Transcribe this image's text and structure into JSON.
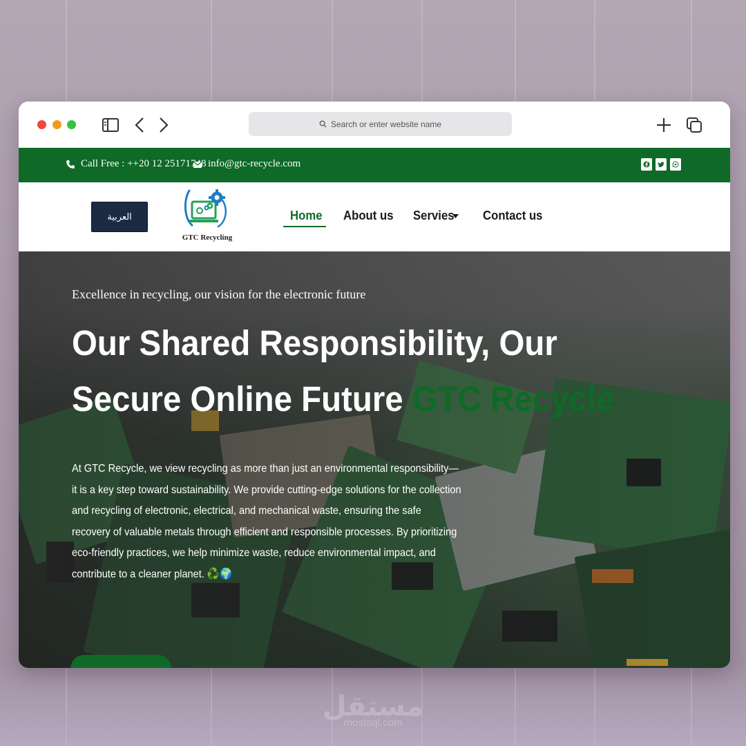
{
  "browser": {
    "address_placeholder": "Search or enter website name"
  },
  "topbar": {
    "phone": "Call Free : ++20 12 25171748",
    "email": "info@gtc-recycle.com",
    "social": [
      "facebook-icon",
      "twitter-icon",
      "whatsapp-icon"
    ]
  },
  "nav": {
    "language_button": "العربية",
    "logo_text": "GTC Recycling",
    "items": [
      {
        "label": "Home",
        "active": true
      },
      {
        "label": "About us"
      },
      {
        "label": "Servies",
        "has_dropdown": true
      },
      {
        "label": "Contact us"
      }
    ]
  },
  "hero": {
    "tagline": "Excellence in recycling, our vision for the electronic future",
    "title_part1": "Our Shared Responsibility, Our Secure Online Future ",
    "title_brand": "GTC Recycle",
    "body": "At GTC Recycle, we view recycling as more than just an environmental responsibility—it is a key step toward sustainability. We provide cutting-edge solutions for the collection and recycling of electronic, electrical, and mechanical waste, ensuring the safe recovery of valuable metals through efficient and responsible processes. By prioritizing eco-friendly practices, we help minimize waste, reduce environmental impact, and contribute to a cleaner planet. ♻️🌍"
  },
  "watermark": {
    "text": "مستقل",
    "sub": "mostaql.com"
  },
  "colors": {
    "brand_green": "#0e6a26",
    "lang_button": "#1c2a44"
  }
}
